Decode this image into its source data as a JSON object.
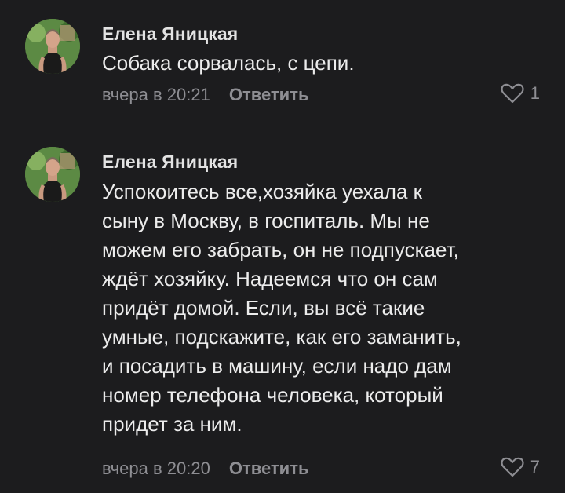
{
  "colors": {
    "background": "#1c1c1e",
    "text": "#ececec",
    "secondary": "#8e8e93"
  },
  "comments": [
    {
      "author": "Елена Яницкая",
      "lines": [
        "Собака сорвалась, с цепи."
      ],
      "time": "вчера в 20:21",
      "reply_label": "Ответить",
      "likes": "1",
      "like_icon": "heart-icon"
    },
    {
      "author": "Елена Яницкая",
      "lines": [
        "Успокоитесь все,хозяйка уехала к",
        "сыну в Москву, в госпиталь. Мы не",
        "можем его забрать, он не подпускает,",
        "ждёт хозяйку. Надеемся что он сам",
        "придёт домой. Если, вы всё такие",
        "умные, подскажите, как его заманить,",
        "и посадить в машину, если надо дам",
        "номер телефона человека, который",
        "придет за ним."
      ],
      "time": "вчера в 20:20",
      "reply_label": "Ответить",
      "likes": "7",
      "like_icon": "heart-icon"
    }
  ]
}
